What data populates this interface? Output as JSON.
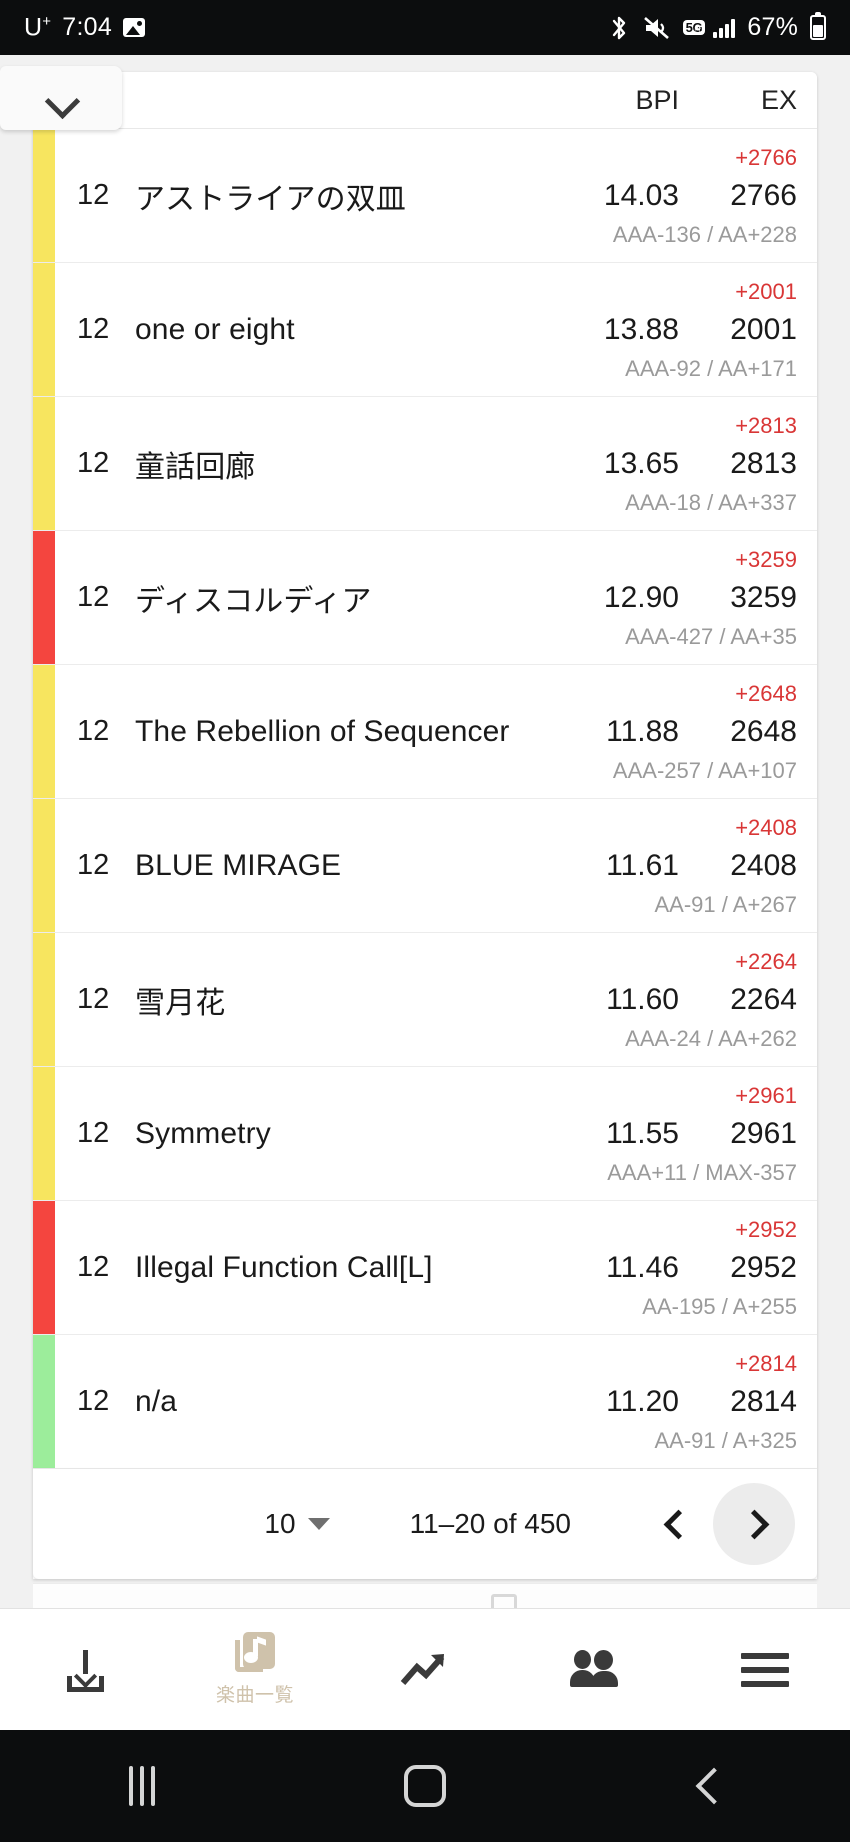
{
  "status_bar": {
    "carrier": "U",
    "carrier_sup": "+",
    "clock": "7:04",
    "battery": "67%",
    "icons": [
      "photo-icon",
      "bluetooth-icon",
      "mute-icon",
      "5g-icon",
      "signal-icon",
      "battery-icon"
    ],
    "network_badge": "5G"
  },
  "table": {
    "headers": {
      "bpi": "BPI",
      "ex": "EX"
    },
    "expander_icon": "chevron-down-icon",
    "colors": {
      "yellow": "#f7e55f",
      "red": "#f4453f",
      "green": "#9ced9b",
      "delta": "#d93636",
      "sub": "#9a9a9a"
    },
    "rows": [
      {
        "level": "12",
        "title": "アストライアの双皿",
        "bpi": "14.03",
        "ex": "2766",
        "delta": "+2766",
        "sub": "AAA-136 / AA+228",
        "band": "yellow"
      },
      {
        "level": "12",
        "title": "one or eight",
        "bpi": "13.88",
        "ex": "2001",
        "delta": "+2001",
        "sub": "AAA-92 / AA+171",
        "band": "yellow"
      },
      {
        "level": "12",
        "title": "童話回廊",
        "bpi": "13.65",
        "ex": "2813",
        "delta": "+2813",
        "sub": "AAA-18 / AA+337",
        "band": "yellow"
      },
      {
        "level": "12",
        "title": "ディスコルディア",
        "bpi": "12.90",
        "ex": "3259",
        "delta": "+3259",
        "sub": "AAA-427 / AA+35",
        "band": "red"
      },
      {
        "level": "12",
        "title": "The Rebellion of Sequencer",
        "bpi": "11.88",
        "ex": "2648",
        "delta": "+2648",
        "sub": "AAA-257 / AA+107",
        "band": "yellow"
      },
      {
        "level": "12",
        "title": "BLUE MIRAGE",
        "bpi": "11.61",
        "ex": "2408",
        "delta": "+2408",
        "sub": "AA-91 / A+267",
        "band": "yellow"
      },
      {
        "level": "12",
        "title": "雪月花",
        "bpi": "11.60",
        "ex": "2264",
        "delta": "+2264",
        "sub": "AAA-24 / AA+262",
        "band": "yellow"
      },
      {
        "level": "12",
        "title": "Symmetry",
        "bpi": "11.55",
        "ex": "2961",
        "delta": "+2961",
        "sub": "AAA+11 / MAX-357",
        "band": "yellow"
      },
      {
        "level": "12",
        "title": "Illegal Function Call[L]",
        "bpi": "11.46",
        "ex": "2952",
        "delta": "+2952",
        "sub": "AA-195 / A+255",
        "band": "red"
      },
      {
        "level": "12",
        "title": "n/a",
        "bpi": "11.20",
        "ex": "2814",
        "delta": "+2814",
        "sub": "AA-91 / A+325",
        "band": "green"
      }
    ]
  },
  "pagination": {
    "rows_per_page": "10",
    "range": "11–20 of 450",
    "prev_icon": "chevron-left-icon",
    "next_icon": "chevron-right-icon"
  },
  "bottom_nav": {
    "items": [
      {
        "icon": "download-icon",
        "label": ""
      },
      {
        "icon": "music-list-icon",
        "label": "楽曲一覧"
      },
      {
        "icon": "trending-up-icon",
        "label": ""
      },
      {
        "icon": "people-icon",
        "label": ""
      },
      {
        "icon": "menu-icon",
        "label": ""
      }
    ]
  },
  "system_nav": {
    "recent_icon": "recent-apps-icon",
    "home_icon": "home-icon",
    "back_icon": "back-icon"
  }
}
